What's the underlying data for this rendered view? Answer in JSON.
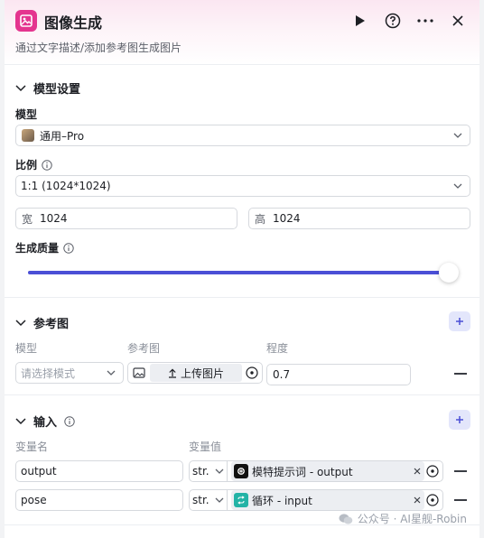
{
  "header": {
    "title": "图像生成",
    "subtitle": "通过文字描述/添加参考图生成图片"
  },
  "model_settings": {
    "section_title": "模型设置",
    "model_label": "模型",
    "model_value": "通用–Pro",
    "ratio_label": "比例",
    "ratio_value": "1:1 (1024*1024)",
    "width_prefix": "宽",
    "width_value": "1024",
    "height_prefix": "高",
    "height_value": "1024",
    "quality_label": "生成质量",
    "quality_level": 0.98
  },
  "reference": {
    "section_title": "参考图",
    "col_model": "模型",
    "col_image": "参考图",
    "col_degree": "程度",
    "mode_placeholder": "请选择模式",
    "upload_label": "上传图片",
    "degree_value": "0.7"
  },
  "input": {
    "section_title": "输入",
    "col_name": "变量名",
    "col_value": "变量值",
    "rows": [
      {
        "name": "output",
        "type": "str.",
        "ref_label": "模特提示词 - output"
      },
      {
        "name": "pose",
        "type": "str.",
        "ref_label": "循环 - input"
      }
    ]
  },
  "watermark": "公众号 · AI星舰-Robin",
  "colors": {
    "accent": "#4b4fd6",
    "app_icon": "#e4358f",
    "loop_icon": "#23b3a6"
  }
}
